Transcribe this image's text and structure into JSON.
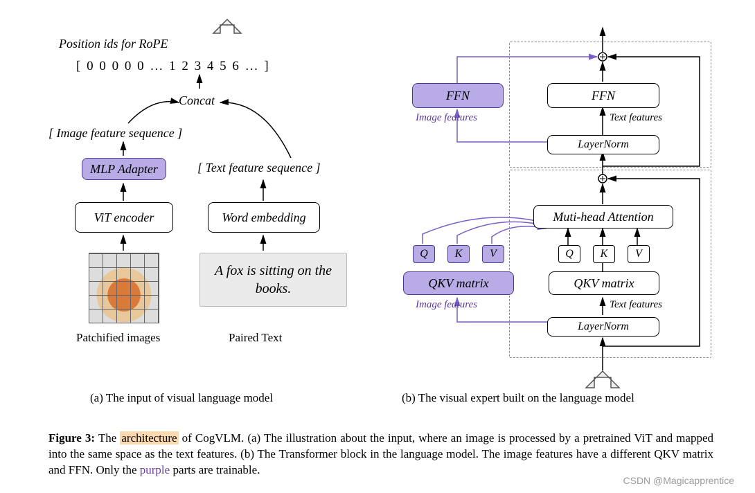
{
  "left": {
    "rope_label": "Position ids for RoPE",
    "rope_ids": "[  0  0  0  0  0  …  1  2  3  4  5  6  …  ]",
    "concat": "Concat",
    "image_feat_seq": "[ Image feature sequence ]",
    "text_feat_seq": "[ Text  feature sequence ]",
    "mlp_adapter": "MLP Adapter",
    "vit_encoder": "ViT encoder",
    "word_embedding": "Word embedding",
    "paired_text": "A fox is sitting on the books.",
    "patchified": "Patchified images",
    "paired_label": "Paired Text",
    "subcaption": "(a) The input of visual language model"
  },
  "right": {
    "ffn_left": "FFN",
    "ffn_right": "FFN",
    "layernorm_top": "LayerNorm",
    "image_features_top": "Image features",
    "text_features_top": "Text features",
    "mha": "Muti-head Attention",
    "q": "Q",
    "k": "K",
    "v": "V",
    "qkv_left": "QKV matrix",
    "qkv_right": "QKV matrix",
    "layernorm_bottom": "LayerNorm",
    "image_features_bottom": "Image features",
    "text_features_bottom": "Text features",
    "subcaption": "(b) The visual expert built on the language model"
  },
  "caption": {
    "fignum": "Figure 3:",
    "t1": " The ",
    "hl": "architecture",
    "t2": " of CogVLM. (a) The illustration about the input, where an image is processed by a pretrained ViT and mapped into the same space as the text features. (b) The Transformer block in the language model. The image features have a different QKV matrix and FFN. Only the ",
    "purple": "purple",
    "t3": " parts are trainable."
  },
  "watermark": "CSDN @Magicapprentice"
}
